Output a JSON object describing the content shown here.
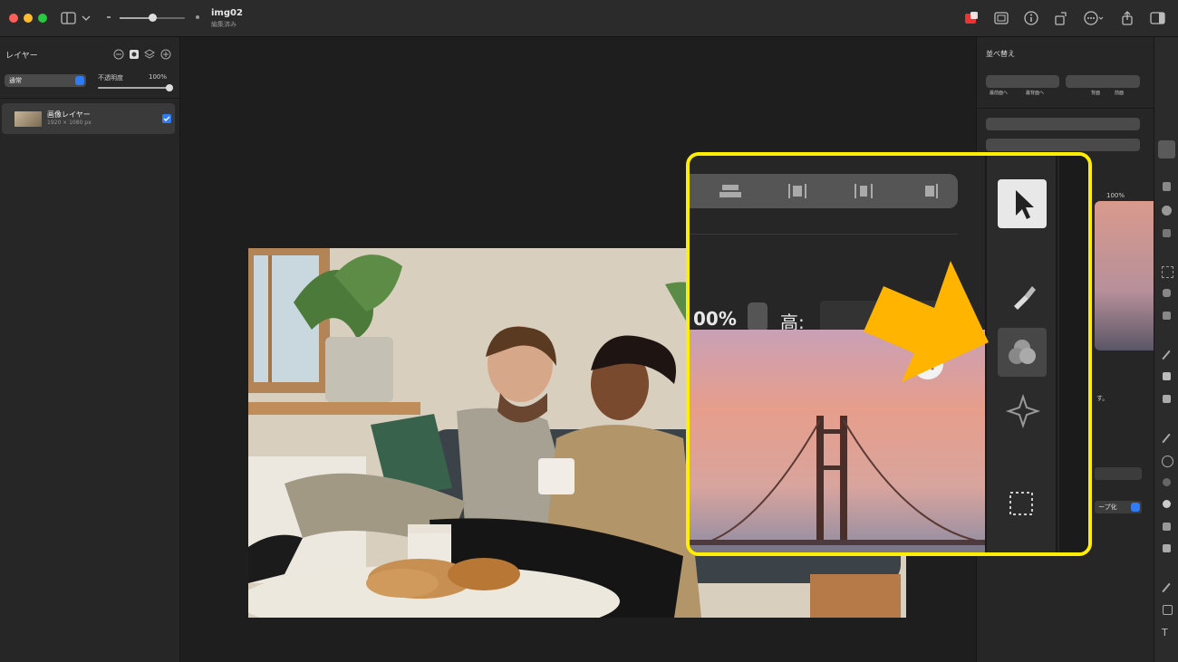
{
  "window": {
    "title": "img02",
    "subtitle": "編集済み"
  },
  "layers_panel": {
    "title": "レイヤー",
    "blend_mode": "通常",
    "opacity_label": "不透明度",
    "opacity_value": "100%",
    "layer": {
      "name": "画像レイヤー",
      "size": "1920 × 1080 px",
      "visible": true
    }
  },
  "arrange_panel": {
    "title": "並べ替え",
    "buttons": [
      "最前面へ",
      "最背面へ",
      "背面",
      "前面"
    ],
    "opacity_value": "100%",
    "note": "す。",
    "dropdown_label": "ープ化"
  },
  "zoom_callout": {
    "percent_value": "00%",
    "height_label": "高:",
    "highlight_color": "#ffee00",
    "arrow_color": "#ffb400",
    "selected_tool": "arrow-pointer-icon",
    "highlighted_tool": "shape-style-icon"
  }
}
